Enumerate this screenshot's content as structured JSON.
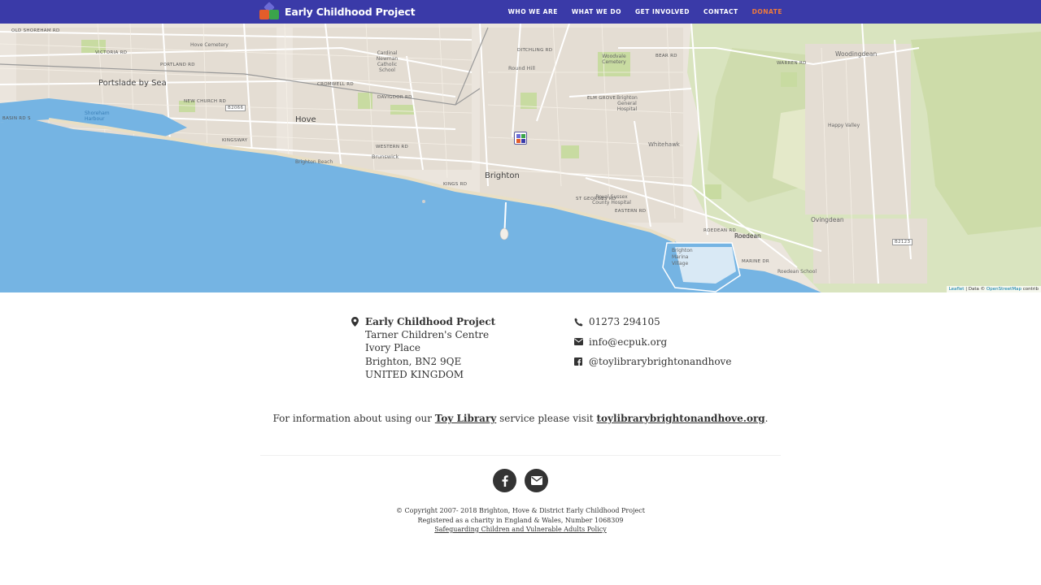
{
  "header": {
    "brand": "Early Childhood Project",
    "nav": [
      {
        "label": "WHO WE ARE"
      },
      {
        "label": "WHAT WE DO"
      },
      {
        "label": "GET INVOLVED"
      },
      {
        "label": "CONTACT"
      },
      {
        "label": "DONATE"
      }
    ],
    "donate_color": "#f07b3a",
    "bar_color": "#3a3aa8"
  },
  "map": {
    "places": [
      "Portslade by Sea",
      "Hove",
      "Brighton",
      "Whitehawk",
      "Woodingdean",
      "Ovingdean",
      "Roedean",
      "Round Hill",
      "Happy Valley",
      "Brunswick",
      "Brighton Marina Village"
    ],
    "minor_labels": [
      "Hove Cemetery",
      "Cardinal Newman Catholic School",
      "Woodvale Cemetery",
      "Brighton General Hospital",
      "Royal Sussex County Hospital",
      "Brighton Beach",
      "Roedean School",
      "Shoreham Harbour"
    ],
    "roads": [
      "OLD SHOREHAM RD",
      "VICTORIA RD",
      "PORTLAND RD",
      "NEW CHURCH RD",
      "KINGSWAY",
      "CROMWELL RD",
      "DAVIGDOR RD",
      "WESTERN RD",
      "KINGS RD",
      "ST GEORGES RD",
      "EASTERN RD",
      "BEAR RD",
      "WARREN RD",
      "MARINE DR",
      "ELM GROVE",
      "DITCHLING RD",
      "BASIN RD S",
      "B2066",
      "B2123",
      "ROEDEAN RD"
    ],
    "attribution": {
      "leaflet": "Leaflet",
      "data": "| Data ©",
      "osm": "OpenStreetMap",
      "contrib": "contrib"
    }
  },
  "address": {
    "org": "Early Childhood Project",
    "line1": "Tarner Children's Centre",
    "line2": "Ivory Place",
    "line3": "Brighton, BN2 9QE",
    "line4": "UNITED KINGDOM"
  },
  "contact": {
    "phone": "01273 294105",
    "email": "info@ecpuk.org",
    "facebook": "@toylibrarybrightonandhove"
  },
  "info": {
    "prefix": "For information about using our",
    "link1": "Toy Library",
    "middle": "service please visit",
    "link2": "toylibrarybrightonandhove.org",
    "suffix": "."
  },
  "footer": {
    "copyright": "© Copyright 2007- 2018 Brighton, Hove & District Early Childhood Project",
    "charity": "Registered as a charity in England & Wales, Number 1068309",
    "policy": "Safeguarding Children and Vulnerable Adults Policy"
  }
}
